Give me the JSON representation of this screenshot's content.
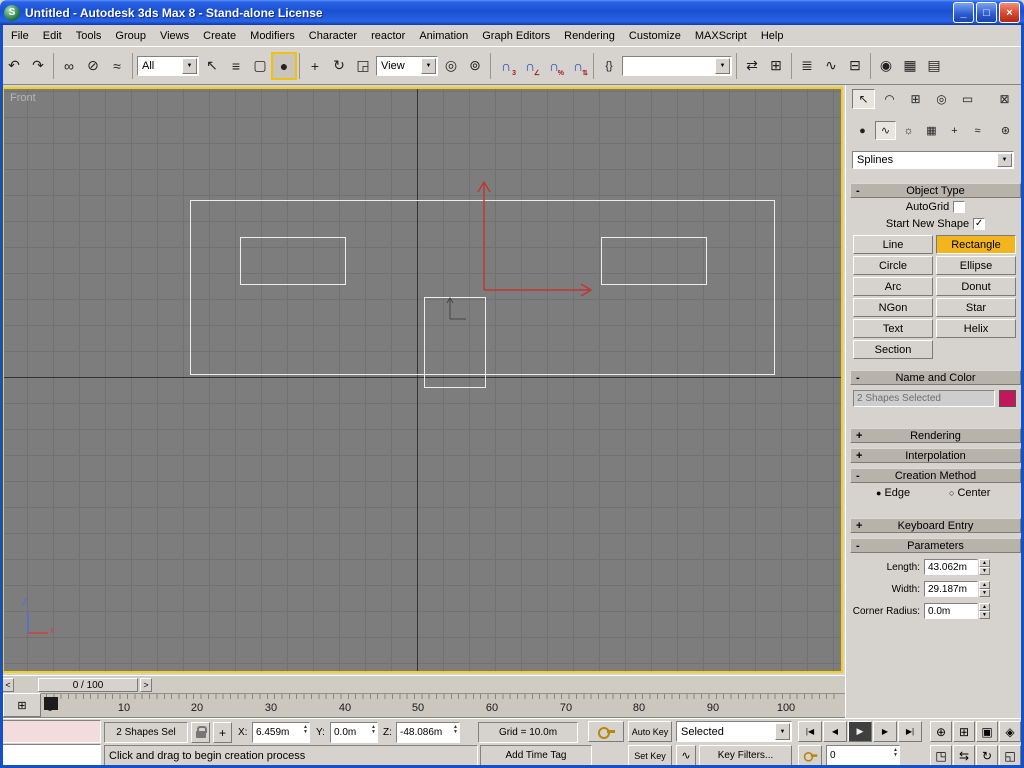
{
  "colors": {
    "titlebar_blue": "#1a50d0",
    "active_button_yellow": "#f3b51d",
    "viewport_border_yellow": "#f2d013",
    "gizmo_red": "#bf3632"
  },
  "window": {
    "title": "Untitled - Autodesk 3ds Max 8  - Stand-alone License"
  },
  "menu": {
    "items": [
      "File",
      "Edit",
      "Tools",
      "Group",
      "Views",
      "Create",
      "Modifiers",
      "Character",
      "reactor",
      "Animation",
      "Graph Editors",
      "Rendering",
      "Customize",
      "MAXScript",
      "Help"
    ]
  },
  "toolbar": {
    "selection_filter_value": "All",
    "coord_system_value": "View",
    "named_selection_value": ""
  },
  "viewport": {
    "label": "Front"
  },
  "timeline": {
    "slider_label": "0 / 100",
    "ticks": [
      "0",
      "10",
      "20",
      "30",
      "40",
      "50",
      "60",
      "70",
      "80",
      "90",
      "100"
    ]
  },
  "command_panel": {
    "category_dropdown_value": "Splines",
    "object_type": {
      "sign": "-",
      "title": "Object Type",
      "autogrid": "AutoGrid",
      "start_new_shape": "Start New Shape",
      "buttons": [
        "Line",
        "Rectangle",
        "Circle",
        "Ellipse",
        "Arc",
        "Donut",
        "NGon",
        "Star",
        "Text",
        "Helix",
        "Section"
      ],
      "active_button": "Rectangle"
    },
    "name_color": {
      "sign": "-",
      "title": "Name and Color",
      "value": "2 Shapes Selected",
      "swatch_color": "#c2185b"
    },
    "rendering": {
      "sign": "+",
      "title": "Rendering"
    },
    "interpolation": {
      "sign": "+",
      "title": "Interpolation"
    },
    "creation_method": {
      "sign": "-",
      "title": "Creation Method",
      "edge": "Edge",
      "center": "Center",
      "selected": "Edge"
    },
    "keyboard_entry": {
      "sign": "+",
      "title": "Keyboard Entry"
    },
    "parameters": {
      "sign": "-",
      "title": "Parameters",
      "length_label": "Length:",
      "length_value": "43.062m",
      "width_label": "Width:",
      "width_value": "29.187m",
      "corner_label": "Corner Radius:",
      "corner_value": "0.0m"
    }
  },
  "status_bar": {
    "selection_text": "2 Shapes Sel",
    "x_label": "X:",
    "x_value": "6.459m",
    "y_label": "Y:",
    "y_value": "0.0m",
    "z_label": "Z:",
    "z_value": "-48.086m",
    "grid_text": "Grid = 10.0m",
    "prompt": "Click and drag to begin creation process",
    "add_time_tag": "Add Time Tag",
    "auto_key": "Auto Key",
    "set_key": "Set Key",
    "key_mode_value": "Selected",
    "key_filters": "Key Filters...",
    "frame_value": "0"
  },
  "icons": {
    "logo": "S",
    "minimize": "_",
    "maximize": "□",
    "close": "×",
    "undo": "↶",
    "redo": "↷",
    "select_link": "∞",
    "unlink": "⊘",
    "bind": "≈",
    "select": "↖",
    "by_name": "≡",
    "region_rect": "▢",
    "region_circle": "●",
    "move": "+",
    "rotate": "↻",
    "scale": "◲",
    "pivot": "◎",
    "manipulate": "⊚",
    "magnet": "∩",
    "snap3": "3",
    "snap_angle": "∠",
    "snap_percent": "%",
    "snap_spinner": "⇅",
    "named_sel": "{}",
    "mirror": "⇄",
    "align": "⊞",
    "layers": "≣",
    "curve_editor": "∿",
    "schematic": "⊟",
    "material": "◉",
    "render": "▦",
    "quick_render": "▤",
    "arrow_down": "▼",
    "check": "✓",
    "radio_on": "●",
    "radio_off": "○",
    "spin_up": "▲",
    "spin_down": "▼",
    "tab_create": "↖",
    "tab_modify": "◠",
    "tab_hier": "⊞",
    "tab_motion": "◎",
    "tab_display": "▭",
    "tab_utils": "⊠",
    "cat_geometry": "●",
    "cat_shapes": "∿",
    "cat_lights": "☼",
    "cat_cameras": "▦",
    "cat_helpers": "+",
    "cat_warps": "≈",
    "cat_systems": "⊛",
    "go_start": "|◀",
    "prev_frame": "◀",
    "play": "▶",
    "next_frame": "▶",
    "go_end": "▶|",
    "zoom": "⊕",
    "zoom_all": "⊞",
    "zoom_ext": "▣",
    "zoom_ext_all": "◈",
    "zoom_region": "◳",
    "pan": "⇆",
    "arc_rotate": "↻",
    "minmax": "◱",
    "slider_left": "<",
    "slider_right": ">",
    "axis_z": "Z",
    "axis_x": "x",
    "mtv": "⊞"
  }
}
